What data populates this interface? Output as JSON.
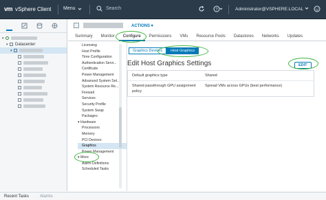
{
  "header": {
    "app_title": "vSphere Client",
    "menu_label": "Menu",
    "search_label": "Search",
    "user": "Administrator@VSPHERE.LOCAL"
  },
  "navigator": {
    "tree": [
      {
        "label": "",
        "level": 0,
        "type": "vcenter"
      },
      {
        "label": "Datacenter",
        "level": 1,
        "type": "datacenter"
      },
      {
        "label": "",
        "level": 2,
        "type": "host",
        "selected": true
      },
      {
        "label": "",
        "level": 3,
        "type": "vm"
      },
      {
        "label": "",
        "level": 3,
        "type": "vm"
      },
      {
        "label": "",
        "level": 3,
        "type": "vm"
      },
      {
        "label": "",
        "level": 3,
        "type": "vm"
      },
      {
        "label": "",
        "level": 3,
        "type": "vm"
      },
      {
        "label": "",
        "level": 3,
        "type": "vm"
      },
      {
        "label": "",
        "level": 3,
        "type": "vm"
      },
      {
        "label": "",
        "level": 3,
        "type": "vm"
      },
      {
        "label": "",
        "level": 3,
        "type": "vm"
      }
    ]
  },
  "object": {
    "actions_label": "ACTIONS"
  },
  "tabs": [
    "Summary",
    "Monitor",
    "Configure",
    "Permissions",
    "VMs",
    "Resource Pools",
    "Datastores",
    "Networks",
    "Updates"
  ],
  "active_tab": "Configure",
  "config_menu": [
    {
      "label": "Licensing",
      "kind": "item"
    },
    {
      "label": "Host Profile",
      "kind": "item"
    },
    {
      "label": "Time Configuration",
      "kind": "item"
    },
    {
      "label": "Authentication Servi...",
      "kind": "item"
    },
    {
      "label": "Certificate",
      "kind": "item"
    },
    {
      "label": "Power Management",
      "kind": "item"
    },
    {
      "label": "Advanced System Set...",
      "kind": "item"
    },
    {
      "label": "System Resource Re...",
      "kind": "item"
    },
    {
      "label": "Firewall",
      "kind": "item"
    },
    {
      "label": "Services",
      "kind": "item"
    },
    {
      "label": "Security Profile",
      "kind": "item"
    },
    {
      "label": "System Swap",
      "kind": "item"
    },
    {
      "label": "Packages",
      "kind": "item"
    },
    {
      "label": "Hardware",
      "kind": "group"
    },
    {
      "label": "Processors",
      "kind": "item"
    },
    {
      "label": "Memory",
      "kind": "item"
    },
    {
      "label": "PCI Devices",
      "kind": "item"
    },
    {
      "label": "Graphics",
      "kind": "item",
      "active": true
    },
    {
      "label": "Power Management",
      "kind": "item"
    },
    {
      "label": "More",
      "kind": "group"
    },
    {
      "label": "Alarm Definitions",
      "kind": "item"
    },
    {
      "label": "Scheduled Tasks",
      "kind": "item"
    }
  ],
  "graphics": {
    "segments": [
      "Graphics Devices",
      "Host Graphics"
    ],
    "active_segment": "Host Graphics",
    "title": "Edit Host Graphics Settings",
    "edit_label": "EDIT",
    "settings": [
      {
        "label": "Default graphics type",
        "value": "Shared"
      },
      {
        "label": "Shared passthrough GPU assignment policy",
        "value": "Spread VMs across GPUs (best performance)"
      }
    ]
  },
  "bottom": {
    "recent_tasks": "Recent Tasks",
    "alarms": "Alarms"
  },
  "colors": {
    "header_bg": "#2b3b4a",
    "accent": "#0079b8",
    "highlight_oval": "#3fb43f"
  }
}
